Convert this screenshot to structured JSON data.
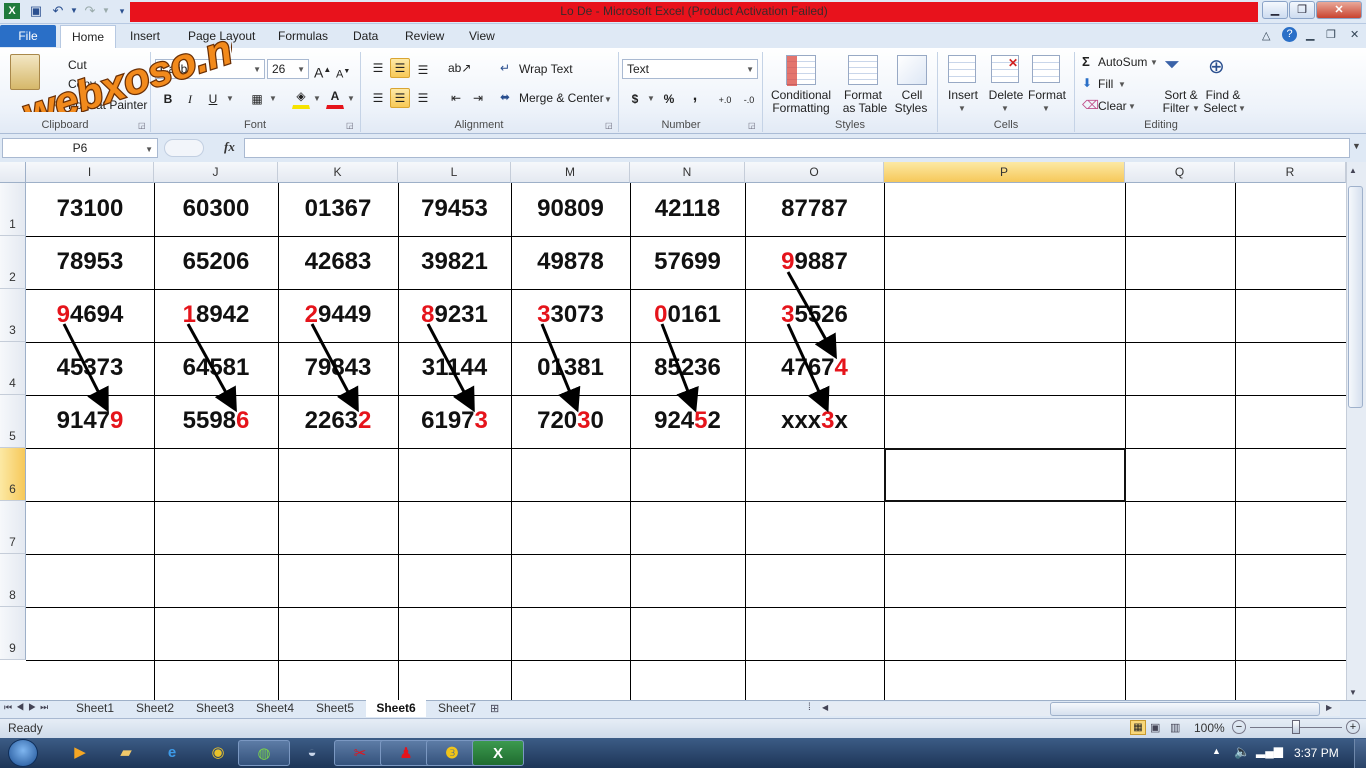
{
  "window": {
    "title": "Lo De  -  Microsoft Excel (Product Activation Failed)",
    "watermark": "webxoso.net"
  },
  "tabs": [
    "File",
    "Home",
    "Insert",
    "Page Layout",
    "Formulas",
    "Data",
    "Review",
    "View"
  ],
  "ribbon": {
    "clipboard": {
      "cut": "Cut",
      "copy": "Copy",
      "format_painter": "Format Painter",
      "label": "Clipboard"
    },
    "font": {
      "name": "Calibri",
      "size": "26",
      "label": "Font"
    },
    "alignment": {
      "wrap": "Wrap Text",
      "merge": "Merge & Center",
      "label": "Alignment"
    },
    "number": {
      "format": "Text",
      "currency": "$",
      "percent": "%",
      "comma": ",",
      "inc": "+.0",
      "dec": "-.0",
      "label": "Number"
    },
    "styles": {
      "conditional_1": "Conditional",
      "conditional_2": "Formatting",
      "table_1": "Format",
      "table_2": "as Table",
      "cell_1": "Cell",
      "cell_2": "Styles",
      "label": "Styles"
    },
    "cells": {
      "insert": "Insert",
      "delete": "Delete",
      "format": "Format",
      "label": "Cells"
    },
    "editing": {
      "autosum": "AutoSum",
      "fill": "Fill",
      "clear": "Clear",
      "sort_1": "Sort &",
      "sort_2": "Filter",
      "find_1": "Find &",
      "find_2": "Select",
      "label": "Editing"
    }
  },
  "formula_bar": {
    "name_box": "P6",
    "fx": "fx",
    "value": ""
  },
  "grid": {
    "columns": [
      "I",
      "J",
      "K",
      "L",
      "M",
      "N",
      "O",
      "P",
      "Q",
      "R"
    ],
    "selected_column": "P",
    "rows": [
      "1",
      "2",
      "3",
      "4",
      "5",
      "6",
      "7",
      "8",
      "9"
    ],
    "selected_row": "6",
    "cells": [
      [
        "73100",
        "60300",
        "01367",
        "79453",
        "90809",
        "42118",
        "87787"
      ],
      [
        "78953",
        "65206",
        "42683",
        "39821",
        "49878",
        "57699",
        "99887"
      ],
      [
        "94694",
        "18942",
        "29449",
        "89231",
        "33073",
        "00161",
        "35526"
      ],
      [
        "45373",
        "64581",
        "79843",
        "31144",
        "01381",
        "85236",
        "47674"
      ],
      [
        "91479",
        "55986",
        "22632",
        "61973",
        "72030",
        "92452",
        "xxx3x"
      ]
    ],
    "highlight_color": "#e5141b"
  },
  "sheets": [
    "Sheet1",
    "Sheet2",
    "Sheet3",
    "Sheet4",
    "Sheet5",
    "Sheet6",
    "Sheet7"
  ],
  "active_sheet": "Sheet6",
  "status": {
    "mode": "Ready",
    "zoom": "100%"
  },
  "taskbar": {
    "time": "3:37 PM"
  }
}
